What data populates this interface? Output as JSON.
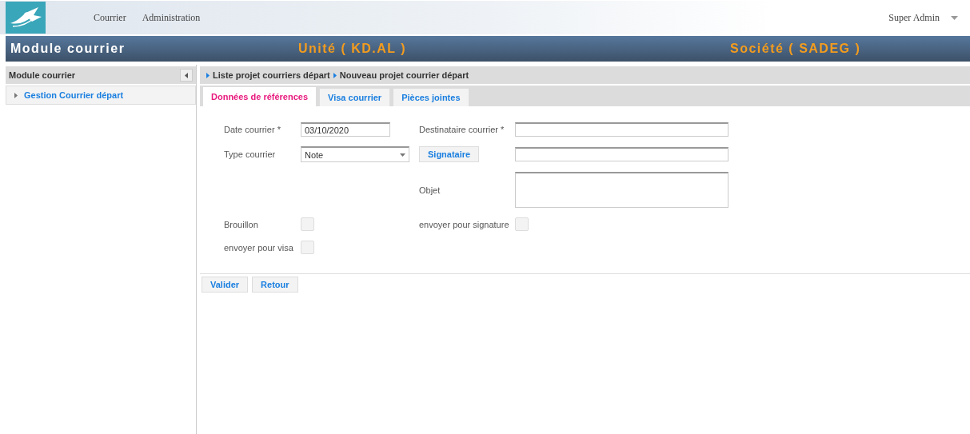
{
  "top_bar": {
    "nav": [
      "Courrier",
      "Administration"
    ],
    "user": "Super Admin"
  },
  "header": {
    "title": "Module courrier",
    "unit": "Unité ( KD.AL )",
    "company": "Société ( SADEG )"
  },
  "sidebar": {
    "title": "Module courrier",
    "items": [
      {
        "label": "Gestion Courrier départ",
        "expanded": false
      }
    ]
  },
  "breadcrumb": [
    "Liste projet courriers départ",
    "Nouveau projet courrier départ"
  ],
  "tabs": [
    {
      "label": "Données de références",
      "selected": true
    },
    {
      "label": "Visa courrier",
      "selected": false
    },
    {
      "label": "Pièces jointes",
      "selected": false
    }
  ],
  "form_rows": [
    {
      "left": {
        "kind": "text",
        "label": "Date courrier *",
        "value": "03/10/2020"
      },
      "right": {
        "kind": "text",
        "label": "Destinataire courrier *"
      }
    },
    {
      "left": {
        "kind": "select",
        "label": "Type courrier",
        "value": "Note"
      },
      "right": {
        "kind": "button-input",
        "label": "Signataire"
      }
    },
    {
      "right": {
        "kind": "textarea",
        "label": "Objet"
      }
    },
    {
      "left": {
        "kind": "checkbox",
        "label": "Brouillon",
        "checked": false
      },
      "right": {
        "kind": "checkbox",
        "label": "envoyer pour signature",
        "checked": false
      }
    },
    {
      "left": {
        "kind": "checkbox",
        "label": "envoyer pour visa",
        "checked": false
      }
    }
  ],
  "buttons": [
    "Valider",
    "Retour"
  ]
}
